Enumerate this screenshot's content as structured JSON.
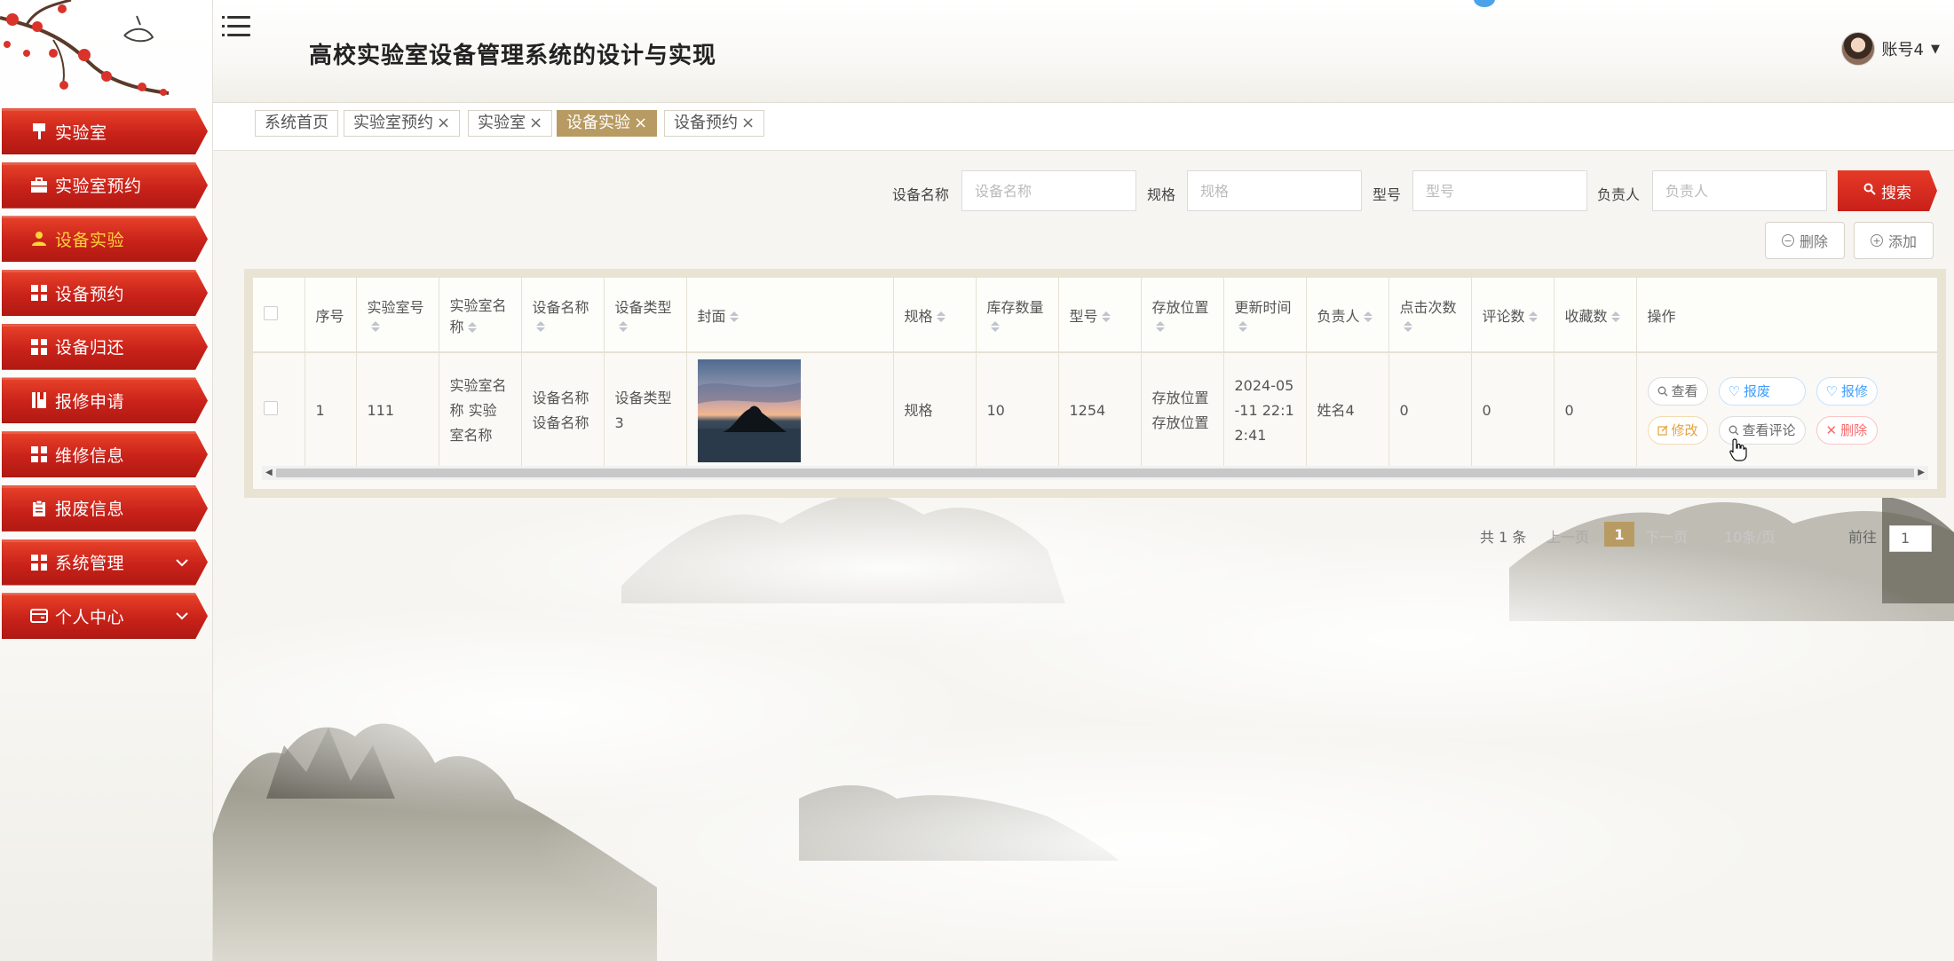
{
  "app": {
    "title": "高校实验室设备管理系统的设计与实现"
  },
  "user": {
    "name": "账号4"
  },
  "sidebar": {
    "items": [
      {
        "label": "实验室",
        "icon": "flag-icon",
        "active": false
      },
      {
        "label": "实验室预约",
        "icon": "briefcase-icon",
        "active": false
      },
      {
        "label": "设备实验",
        "icon": "user-icon",
        "active": true
      },
      {
        "label": "设备预约",
        "icon": "grid-icon",
        "active": false
      },
      {
        "label": "设备归还",
        "icon": "grid-icon",
        "active": false
      },
      {
        "label": "报修申请",
        "icon": "book-icon",
        "active": false
      },
      {
        "label": "维修信息",
        "icon": "grid-icon",
        "active": false
      },
      {
        "label": "报废信息",
        "icon": "clipboard-icon",
        "active": false
      },
      {
        "label": "系统管理",
        "icon": "grid-icon",
        "active": false,
        "expandable": true
      },
      {
        "label": "个人中心",
        "icon": "wallet-icon",
        "active": false,
        "expandable": true
      }
    ]
  },
  "tags": [
    {
      "label": "系统首页",
      "closable": false,
      "active": false
    },
    {
      "label": "实验室预约",
      "closable": true,
      "active": false
    },
    {
      "label": "实验室",
      "closable": true,
      "active": false
    },
    {
      "label": "设备实验",
      "closable": true,
      "active": true
    },
    {
      "label": "设备预约",
      "closable": true,
      "active": false
    }
  ],
  "search": {
    "fields": [
      {
        "label": "设备名称",
        "placeholder": "设备名称"
      },
      {
        "label": "规格",
        "placeholder": "规格"
      },
      {
        "label": "型号",
        "placeholder": "型号"
      },
      {
        "label": "负责人",
        "placeholder": "负责人"
      }
    ],
    "button_label": "搜索"
  },
  "actions": {
    "delete_label": "删除",
    "add_label": "添加"
  },
  "table": {
    "columns": [
      "序号",
      "实验室号",
      "实验室名称",
      "设备名称",
      "设备类型",
      "封面",
      "规格",
      "库存数量",
      "型号",
      "存放位置",
      "更新时间",
      "负责人",
      "点击次数",
      "评论数",
      "收藏数",
      "操作"
    ],
    "rows": [
      {
        "index": "1",
        "lab_no": "111",
        "lab_name": "实验室名称 实验室名称",
        "device_name": "设备名称设备名称",
        "device_type": "设备类型3",
        "spec": "规格",
        "stock": "10",
        "model": "1254",
        "location": "存放位置存放位置",
        "updated": "2024-05-11 22:12:41",
        "owner": "姓名4",
        "clicks": "0",
        "comments": "0",
        "favorites": "0"
      }
    ],
    "row_actions": {
      "view": "查看",
      "scrap": "报废",
      "repair": "报修",
      "edit": "修改",
      "comments": "查看评论",
      "delete": "删除"
    }
  },
  "pagination": {
    "total": "共 1 条",
    "prev": "上一页",
    "current": "1",
    "next": "下一页",
    "page_size": "10条/页",
    "goto": "前往",
    "goto_value": "1"
  }
}
